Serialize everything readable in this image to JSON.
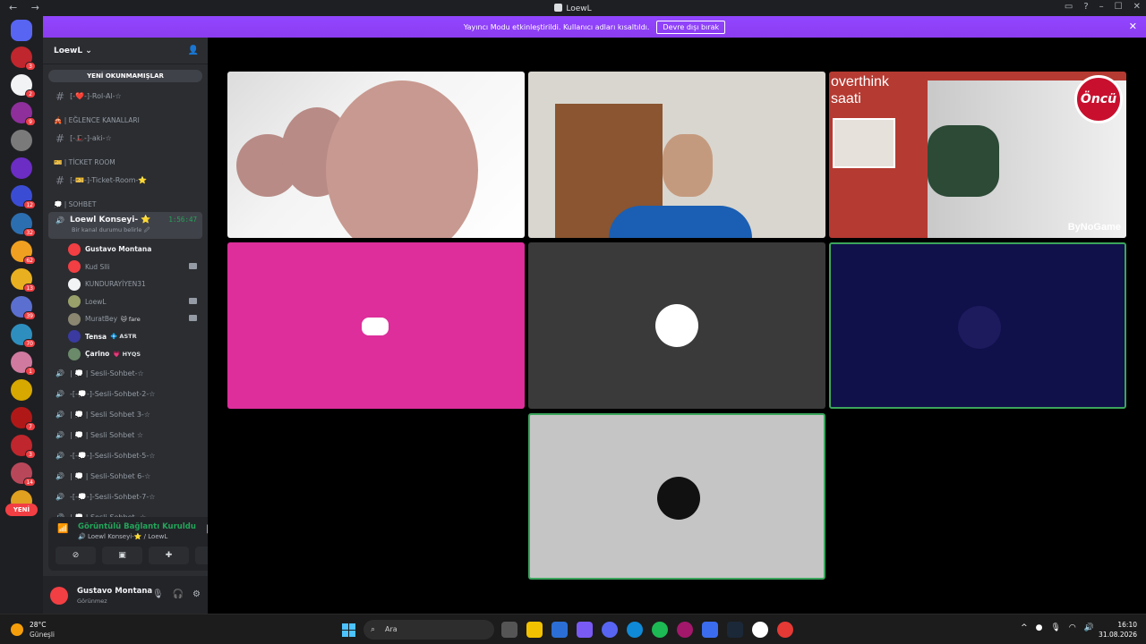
{
  "window": {
    "title": "LoewL",
    "nav": "←  →"
  },
  "banner": {
    "text": "Yayıncı Modu etkinleştirildi. Kullanıcı adları kısaltıldı.",
    "button": "Devre dışı bırak"
  },
  "servers": [
    {
      "badge": "3",
      "color": "#c0262d"
    },
    {
      "badge": "2",
      "color": "#f2f3f5"
    },
    {
      "badge": "9",
      "color": "#8e2f9c"
    },
    {
      "badge": "",
      "color": "#7a7a7a"
    },
    {
      "badge": "",
      "color": "#6b2dc4"
    },
    {
      "badge": "12",
      "color": "#3b4cd4"
    },
    {
      "badge": "32",
      "color": "#2c6fb0"
    },
    {
      "badge": "62",
      "color": "#f0a020"
    },
    {
      "badge": "13",
      "color": "#e8b020"
    },
    {
      "badge": "39",
      "color": "#5b6fd0"
    },
    {
      "badge": "70",
      "color": "#2e8fbf"
    },
    {
      "badge": "1",
      "color": "#d07aa0"
    },
    {
      "badge": "",
      "color": "#d6a800"
    },
    {
      "badge": "7",
      "color": "#b01818"
    },
    {
      "badge": "3",
      "color": "#c0262d"
    },
    {
      "badge": "14",
      "color": "#b9475a"
    },
    {
      "badge": "15",
      "color": "#e0a020"
    }
  ],
  "new_pill": "YENİ",
  "sidebar": {
    "guild_name": "LoewL",
    "unread_pill": "YENİ OKUNMAMIŞLAR",
    "ch_rol": "[-❤️-]-Rol-Al-☆",
    "cat_eglence": "🎪 | EĞLENCE KANALLARI",
    "ch_aki": "[-🎩-]-aki-☆",
    "cat_ticket": "🎫 | TİCKET ROOM",
    "ch_ticket": "[-🎫-]-Ticket-Room-⭐",
    "cat_sohbet": "💭 | SOHBET",
    "active_name": "Loewl Konseyi- ⭐",
    "active_timer": "1:56:47",
    "active_status": "Bir kanal durumu belirle 🖉",
    "members": [
      {
        "name": "Gustavo Montana",
        "tag": "",
        "color": "#f23f43",
        "cam": false,
        "bright": true
      },
      {
        "name": "Kud Slli",
        "tag": "",
        "color": "#f23f43",
        "cam": true,
        "bright": false
      },
      {
        "name": "KUNDURAYİYEN31",
        "tag": "",
        "color": "#f2f3f5",
        "cam": false,
        "bright": false
      },
      {
        "name": "LoewL",
        "tag": "",
        "color": "#9aa06a",
        "cam": true,
        "bright": false
      },
      {
        "name": "MuratBey",
        "tag": "🐱 fare",
        "color": "#8a8670",
        "cam": true,
        "bright": false
      },
      {
        "name": "Tensa",
        "tag": "💠 ASTR",
        "color": "#3a3aa0",
        "cam": false,
        "bright": true
      },
      {
        "name": "Çarino",
        "tag": "💗 HYQS",
        "color": "#6a8a6a",
        "cam": false,
        "bright": true
      }
    ],
    "voice_channels": [
      "| 💭 | Sesli-Sohbet-☆",
      "-[-💭-]-Sesli-Sohbet-2-☆",
      "| 💭 | Sesli Sohbet 3-☆",
      "| 💭 | Sesli Sohbet ☆",
      "-[-💭-]-Sesli-Sohbet-5-☆",
      "| 💭 | Sesli-Sohbet 6-☆",
      "-[-💭-]-Sesli-Sohbet-7-☆",
      "| 💭 | Sesli-Sohbet -☆"
    ]
  },
  "voice_panel": {
    "status": "Görüntülü Bağlantı Kuruldu",
    "channel": "🔊 Loewl Konseyi-⭐ / LoewL"
  },
  "user_panel": {
    "name": "Gustavo Montana",
    "status": "Görünmez"
  },
  "tiles": {
    "overlay_text": "overthink\nsaati",
    "oncu_logo": "Öncü",
    "watermark": "ByNoGame"
  },
  "taskbar": {
    "temp": "28°C",
    "weather": "Güneşli",
    "search": "Ara",
    "time": "16:10",
    "date": "31.08.2026"
  }
}
